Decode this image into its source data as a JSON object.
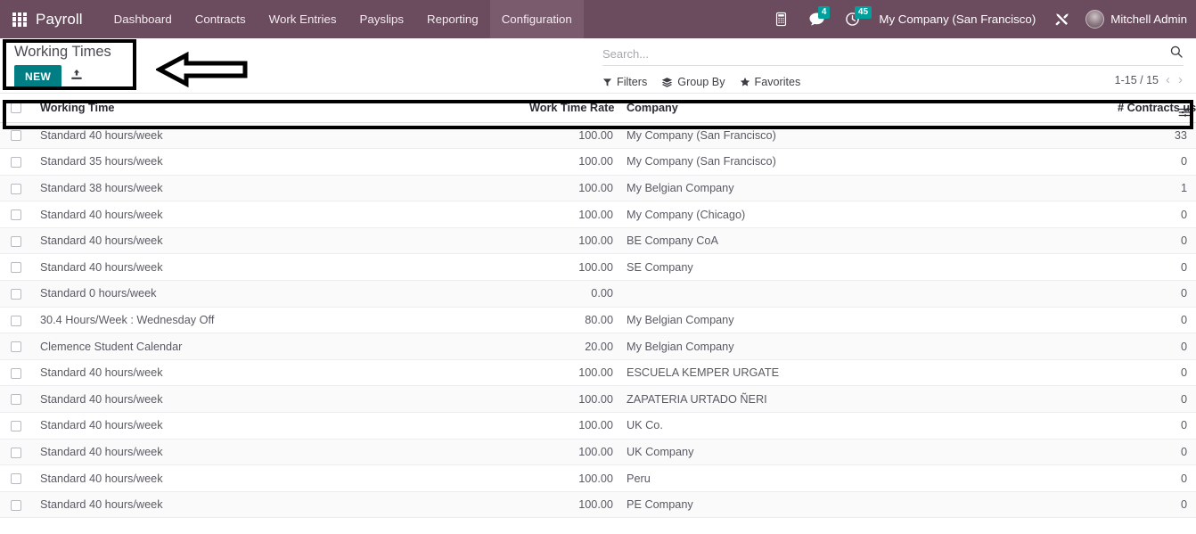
{
  "navbar": {
    "apps_icon": "apps-grid-icon",
    "brand": "Payroll",
    "menu": [
      {
        "label": "Dashboard",
        "active": false
      },
      {
        "label": "Contracts",
        "active": false
      },
      {
        "label": "Work Entries",
        "active": false
      },
      {
        "label": "Payslips",
        "active": false
      },
      {
        "label": "Reporting",
        "active": false
      },
      {
        "label": "Configuration",
        "active": true
      }
    ],
    "systray": {
      "phone_icon": "telephone-icon",
      "messages_icon": "chat-bubble-icon",
      "messages_count": "4",
      "activities_icon": "clock-icon",
      "activities_count": "45",
      "company": "My Company (San Francisco)",
      "tools_icon": "wrench-screwdriver-icon",
      "avatar": "user-avatar",
      "user": "Mitchell Admin"
    }
  },
  "control_panel": {
    "title": "Working Times",
    "new_button": "NEW",
    "import_icon": "import-upload-icon",
    "search": {
      "placeholder": "Search...",
      "value": "",
      "search_icon": "search-magnifier-icon"
    },
    "filters": [
      {
        "label": "Filters",
        "icon": "funnel-icon"
      },
      {
        "label": "Group By",
        "icon": "layers-icon"
      },
      {
        "label": "Favorites",
        "icon": "star-icon"
      }
    ],
    "pager": {
      "range": "1-15 / 15",
      "prev_icon": "chevron-left-icon",
      "next_icon": "chevron-right-icon"
    }
  },
  "list": {
    "columns": [
      "Working Time",
      "Work Time Rate",
      "Company",
      "# Contracts using it"
    ],
    "optional_columns_icon": "column-settings-sliders-icon",
    "rows": [
      {
        "name": "Standard 40 hours/week",
        "rate": "100.00",
        "company": "My Company (San Francisco)",
        "contracts": "33"
      },
      {
        "name": "Standard 35 hours/week",
        "rate": "100.00",
        "company": "My Company (San Francisco)",
        "contracts": "0"
      },
      {
        "name": "Standard 38 hours/week",
        "rate": "100.00",
        "company": "My Belgian Company",
        "contracts": "1"
      },
      {
        "name": "Standard 40 hours/week",
        "rate": "100.00",
        "company": "My Company (Chicago)",
        "contracts": "0"
      },
      {
        "name": "Standard 40 hours/week",
        "rate": "100.00",
        "company": "BE Company CoA",
        "contracts": "0"
      },
      {
        "name": "Standard 40 hours/week",
        "rate": "100.00",
        "company": "SE Company",
        "contracts": "0"
      },
      {
        "name": "Standard 0 hours/week",
        "rate": "0.00",
        "company": "",
        "contracts": "0"
      },
      {
        "name": "30.4 Hours/Week : Wednesday Off",
        "rate": "80.00",
        "company": "My Belgian Company",
        "contracts": "0"
      },
      {
        "name": "Clemence Student Calendar",
        "rate": "20.00",
        "company": "My Belgian Company",
        "contracts": "0"
      },
      {
        "name": "Standard 40 hours/week",
        "rate": "100.00",
        "company": "ESCUELA KEMPER URGATE",
        "contracts": "0"
      },
      {
        "name": "Standard 40 hours/week",
        "rate": "100.00",
        "company": "ZAPATERIA URTADO ÑERI",
        "contracts": "0"
      },
      {
        "name": "Standard 40 hours/week",
        "rate": "100.00",
        "company": "UK Co.",
        "contracts": "0"
      },
      {
        "name": "Standard 40 hours/week",
        "rate": "100.00",
        "company": "UK Company",
        "contracts": "0"
      },
      {
        "name": "Standard 40 hours/week",
        "rate": "100.00",
        "company": "Peru",
        "contracts": "0"
      },
      {
        "name": "Standard 40 hours/week",
        "rate": "100.00",
        "company": "PE Company",
        "contracts": "0"
      }
    ]
  },
  "annotations": {
    "toolbar_box": "black-rectangle-highlight",
    "header_box": "black-rectangle-highlight",
    "arrow": "left-pointing-arrow"
  },
  "colors": {
    "navbar_bg": "#6b4b5e",
    "navbar_active": "#7a5a6d",
    "new_button_bg": "#017e84",
    "badge_bg": "#00a09d",
    "annotation": "#000000",
    "row_alt_bg": "#fafafb"
  }
}
